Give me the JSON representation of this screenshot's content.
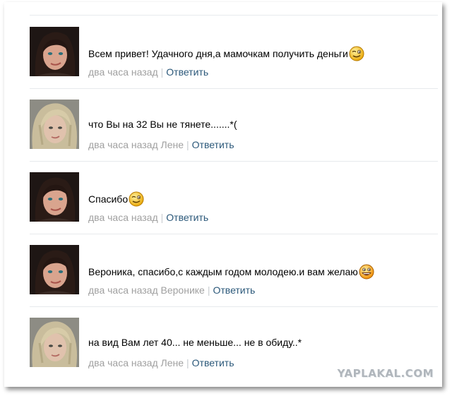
{
  "comments": [
    {
      "avatar": "avatar-dark-hair",
      "text": "Всем привет! Удачного дня,а мамочкам получить деньги",
      "emoji": "wink-smiley-icon",
      "time": "два часа назад",
      "to": "",
      "reply": "Ответить"
    },
    {
      "avatar": "avatar-blonde",
      "text": "что Вы на 32 Вы не тянете.......*(",
      "emoji": "",
      "time": "два часа назад",
      "to": "Лене",
      "reply": "Ответить"
    },
    {
      "avatar": "avatar-dark-hair",
      "text": "Спасибо",
      "emoji": "wink-smiley-icon",
      "time": "два часа назад",
      "to": "",
      "reply": "Ответить"
    },
    {
      "avatar": "avatar-dark-hair",
      "text": "Вероника, спасибо,с каждым годом молодею.и вам желаю",
      "emoji": "grin-smiley-icon",
      "time": "два часа назад",
      "to": "Веронике",
      "reply": "Ответить"
    },
    {
      "avatar": "avatar-blonde",
      "text": "на вид Вам лет 40... не меньше... не в обиду..*",
      "emoji": "",
      "time": "два часа назад",
      "to": "Лене",
      "reply": "Ответить"
    }
  ],
  "watermark": "YAPLAKAL.COM",
  "colors": {
    "link": "#2b587a",
    "meta": "#a0a0a0",
    "separator": "#e7eaed"
  }
}
